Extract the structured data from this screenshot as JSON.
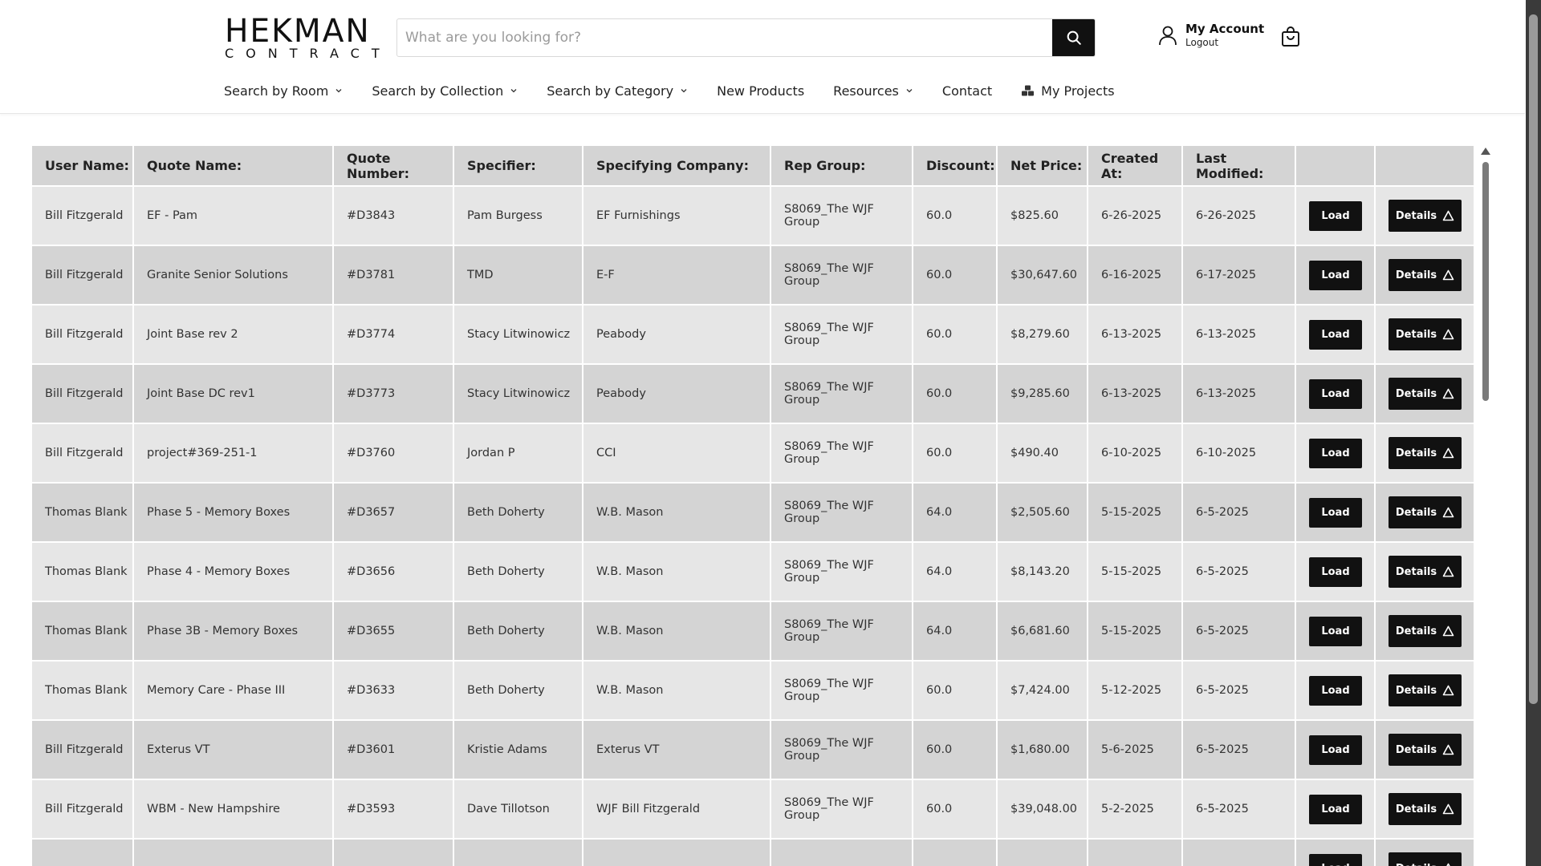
{
  "header": {
    "logo_top": "HEKMAN",
    "logo_bottom": "CONTRACT",
    "search_placeholder": "What are you looking for?",
    "account_label": "My Account",
    "logout_label": "Logout"
  },
  "nav": {
    "items": [
      {
        "label": "Search by Room"
      },
      {
        "label": "Search by Collection"
      },
      {
        "label": "Search by Category"
      },
      {
        "label": "New Products"
      },
      {
        "label": "Resources"
      },
      {
        "label": "Contact"
      },
      {
        "label": "My Projects"
      }
    ]
  },
  "table": {
    "headers": [
      "User Name:",
      "Quote Name:",
      "Quote Number:",
      "Specifier:",
      "Specifying Company:",
      "Rep Group:",
      "Discount:",
      "Net Price:",
      "Created At:",
      "Last Modified:",
      "",
      ""
    ],
    "load_label": "Load",
    "details_label": "Details",
    "rows": [
      [
        "Bill Fitzgerald",
        "EF - Pam",
        "#D3843",
        "Pam Burgess",
        "EF Furnishings",
        "S8069_The WJF Group",
        "60.0",
        "$825.60",
        "6-26-2025",
        "6-26-2025"
      ],
      [
        "Bill Fitzgerald",
        "Granite Senior Solutions",
        "#D3781",
        "TMD",
        "E-F",
        "S8069_The WJF Group",
        "60.0",
        "$30,647.60",
        "6-16-2025",
        "6-17-2025"
      ],
      [
        "Bill Fitzgerald",
        "Joint Base rev 2",
        "#D3774",
        "Stacy Litwinowicz",
        "Peabody",
        "S8069_The WJF Group",
        "60.0",
        "$8,279.60",
        "6-13-2025",
        "6-13-2025"
      ],
      [
        "Bill Fitzgerald",
        "Joint Base DC rev1",
        "#D3773",
        "Stacy Litwinowicz",
        "Peabody",
        "S8069_The WJF Group",
        "60.0",
        "$9,285.60",
        "6-13-2025",
        "6-13-2025"
      ],
      [
        "Bill Fitzgerald",
        "project#369-251-1",
        "#D3760",
        "Jordan P",
        "CCI",
        "S8069_The WJF Group",
        "60.0",
        "$490.40",
        "6-10-2025",
        "6-10-2025"
      ],
      [
        "Thomas Blank",
        "Phase 5 - Memory Boxes",
        "#D3657",
        "Beth Doherty",
        "W.B. Mason",
        "S8069_The WJF Group",
        "64.0",
        "$2,505.60",
        "5-15-2025",
        "6-5-2025"
      ],
      [
        "Thomas Blank",
        "Phase 4 - Memory Boxes",
        "#D3656",
        "Beth Doherty",
        "W.B. Mason",
        "S8069_The WJF Group",
        "64.0",
        "$8,143.20",
        "5-15-2025",
        "6-5-2025"
      ],
      [
        "Thomas Blank",
        "Phase 3B - Memory Boxes",
        "#D3655",
        "Beth Doherty",
        "W.B. Mason",
        "S8069_The WJF Group",
        "64.0",
        "$6,681.60",
        "5-15-2025",
        "6-5-2025"
      ],
      [
        "Thomas Blank",
        "Memory Care - Phase III",
        "#D3633",
        "Beth Doherty",
        "W.B. Mason",
        "S8069_The WJF Group",
        "60.0",
        "$7,424.00",
        "5-12-2025",
        "6-5-2025"
      ],
      [
        "Bill Fitzgerald",
        "Exterus VT",
        "#D3601",
        "Kristie Adams",
        "Exterus VT",
        "S8069_The WJF Group",
        "60.0",
        "$1,680.00",
        "5-6-2025",
        "6-5-2025"
      ],
      [
        "Bill Fitzgerald",
        "WBM - New Hampshire",
        "#D3593",
        "Dave Tillotson",
        "WJF Bill Fitzgerald",
        "S8069_The WJF Group",
        "60.0",
        "$39,048.00",
        "5-2-2025",
        "6-5-2025"
      ],
      [
        "",
        "",
        "",
        "",
        "",
        "",
        "",
        "",
        "",
        ""
      ]
    ]
  }
}
